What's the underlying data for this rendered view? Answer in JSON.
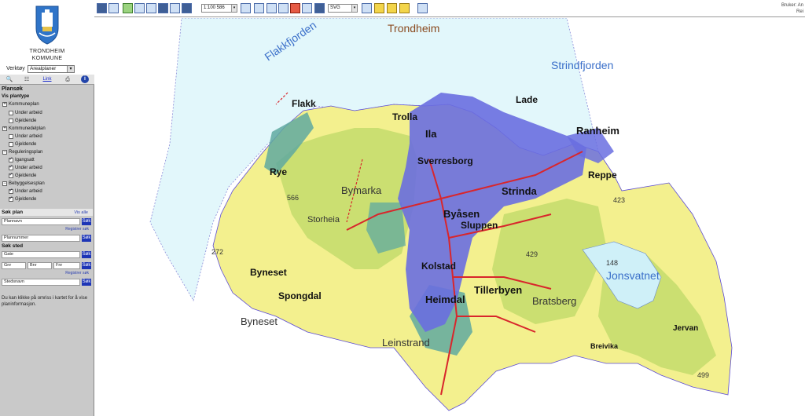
{
  "logo": {
    "line1": "TRONDHEIM",
    "line2": "KOMMUNE"
  },
  "tool": {
    "label": "Verktøy",
    "selected": "Arealplaner"
  },
  "tabs": {
    "link": "Link",
    "icons": [
      "search-icon",
      "layers-icon",
      "link-tab",
      "print-icon",
      "info-icon"
    ]
  },
  "plansok": {
    "title": "Plansøk",
    "vis_plantype": "Vis plantype",
    "groups": [
      {
        "name": "Kommuneplan",
        "items": [
          {
            "label": "Under arbeid",
            "checked": false
          },
          {
            "label": "Gjeldende",
            "checked": false
          }
        ]
      },
      {
        "name": "Kommunedelplan",
        "items": [
          {
            "label": "Under arbeid",
            "checked": false
          },
          {
            "label": "Gjeldende",
            "checked": false
          }
        ]
      },
      {
        "name": "Reguleringsplan",
        "items": [
          {
            "label": "Igangsatt",
            "checked": true
          },
          {
            "label": "Under arbeid",
            "checked": true
          },
          {
            "label": "Gjeldende",
            "checked": true
          }
        ]
      },
      {
        "name": "Bebyggelsesplan",
        "items": [
          {
            "label": "Under arbeid",
            "checked": true
          },
          {
            "label": "Gjeldende",
            "checked": true
          }
        ]
      }
    ]
  },
  "sok_plan": {
    "title": "Søk plan",
    "vis_alle": "Vis alle",
    "plannavn": "Plannavn",
    "plannummer": "Plannummer",
    "registrer": "Registrer søk",
    "sok": "Søk"
  },
  "sok_sted": {
    "title": "Søk sted",
    "gate": "Gate",
    "gnr": "Gnr",
    "bnr": "Bnr",
    "fnr": "Fnr",
    "stedsnavn": "Stedsnavn",
    "registrer": "Registrer søk",
    "sok": "Søk"
  },
  "hint": "Du kan klikke på omriss i kartet for å vise planinformasjon.",
  "toolbar": {
    "scale": "1:100 586",
    "format": "SVG",
    "user_line1": "Bruker: An",
    "user_line2": "Rei"
  },
  "map": {
    "water_labels": [
      "Flakkfjorden",
      "Trondheim",
      "Strindfjorden",
      "Jonsvatnet"
    ],
    "places": [
      "Flakk",
      "Trolla",
      "Ila",
      "Lade",
      "Ranheim",
      "Sverresborg",
      "Rye",
      "Reppe",
      "Strinda",
      "Byåsen",
      "Sluppen",
      "Kolstad",
      "Tillerbyen",
      "Heimdal",
      "Byneset",
      "Spongdal",
      "Jervan",
      "Breivika"
    ],
    "areas": [
      "Bymarka",
      "Storheia",
      "Byneset",
      "Leinstrand",
      "Bratsberg"
    ],
    "heights": [
      "566",
      "272",
      "429",
      "423",
      "148",
      "499"
    ]
  },
  "colors": {
    "sea": "#e2f7fb",
    "land_yellow": "#f3f08e",
    "forest_green": "#c7dd6e",
    "urban_blue": "#6a6ee0",
    "zone_teal": "#5fa9a0",
    "road_red": "#d8262c",
    "lake_blue": "#cff0f8"
  }
}
